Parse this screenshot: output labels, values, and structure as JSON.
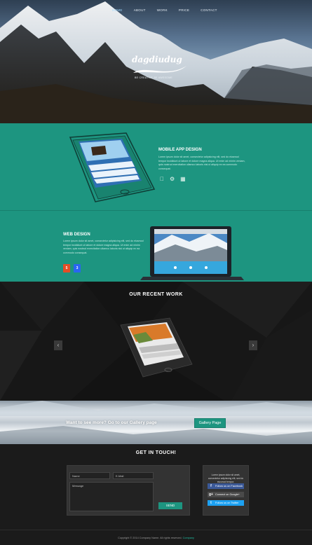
{
  "nav": {
    "items": [
      "HOME",
      "ABOUT",
      "WORK",
      "PRICE",
      "CONTACT"
    ]
  },
  "hero": {
    "logo_text": "dagdiudug",
    "logo_sub": "BE CREATIVE BE AWESOME"
  },
  "mobile_app": {
    "title": "MOBILE APP DESIGN",
    "text": "Lorem ipsum dolor sit amet, consectetur adipisicing elit, sed do eiusmod tempor incididunt ut labore et dolore magna aliqua. Ut enim ad minim veniam, quis nostrud exercitation ullamco laboris nisi ut aliquip ex ea commodo consequat.",
    "platforms": [
      "apple-icon",
      "android-icon",
      "windows-icon"
    ]
  },
  "web_design": {
    "title": "WEB DESIGN",
    "text": "Lorem ipsum dolor sit amet, consectetur adipisicing elit, sed do eiusmod tempor incididunt ut labore et dolore magna aliqua. Ut enim ad minim veniam, quis nostrud exercitation ullamco laboris nisi ut aliquip ex ea commodo consequat.",
    "badges": [
      {
        "label": "5",
        "color": "#e44d26",
        "icon": "html5-icon"
      },
      {
        "label": "3",
        "color": "#2965f1",
        "icon": "css3-icon"
      }
    ]
  },
  "work": {
    "title": "OUR RECENT WORK",
    "prev": "‹",
    "next": "›"
  },
  "gallery": {
    "text": "Want to see more? Go to our Gallery page",
    "button": "Gallery Page"
  },
  "contact": {
    "title": "GET IN TOUCH!",
    "name_placeholder": "Name",
    "email_placeholder": "E-Mail",
    "message_placeholder": "Message",
    "send": "SEND",
    "social_text": "Lorem ipsum dolor sit amet, consectetur adipisicing elit, sed do eiusmod tempor.",
    "social": [
      {
        "label": "Follow us on Facebook",
        "color": "#3b5998",
        "icon": "facebook-icon",
        "glyph": "f"
      },
      {
        "label": "Connect on Google+",
        "color": "#4a4a4a",
        "icon": "google-plus-icon",
        "glyph": "g+"
      },
      {
        "label": "Follow us on Twitter",
        "color": "#1da1f2",
        "icon": "twitter-icon",
        "glyph": "t"
      }
    ]
  },
  "footer": {
    "copyright": "Copyright © 2014 Company Name. All rights reserved.",
    "company": "Company"
  },
  "colors": {
    "accent": "#1d9580",
    "dark": "#171717"
  }
}
